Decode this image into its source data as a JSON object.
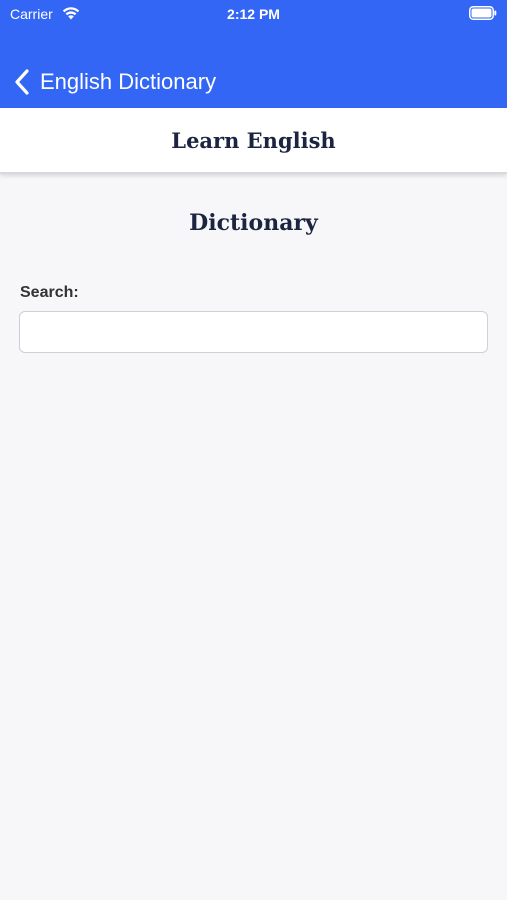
{
  "status_bar": {
    "carrier": "Carrier",
    "time": "2:12 PM"
  },
  "nav": {
    "back_label": "English Dictionary",
    "back_icon": "chevron-left-icon"
  },
  "header": {
    "title": "Learn English"
  },
  "main": {
    "title": "Dictionary",
    "search_label": "Search:",
    "search_value": "",
    "search_placeholder": ""
  },
  "colors": {
    "nav_background": "#3366f4",
    "page_background": "#f7f7f9",
    "heading_text": "#1c2540"
  }
}
